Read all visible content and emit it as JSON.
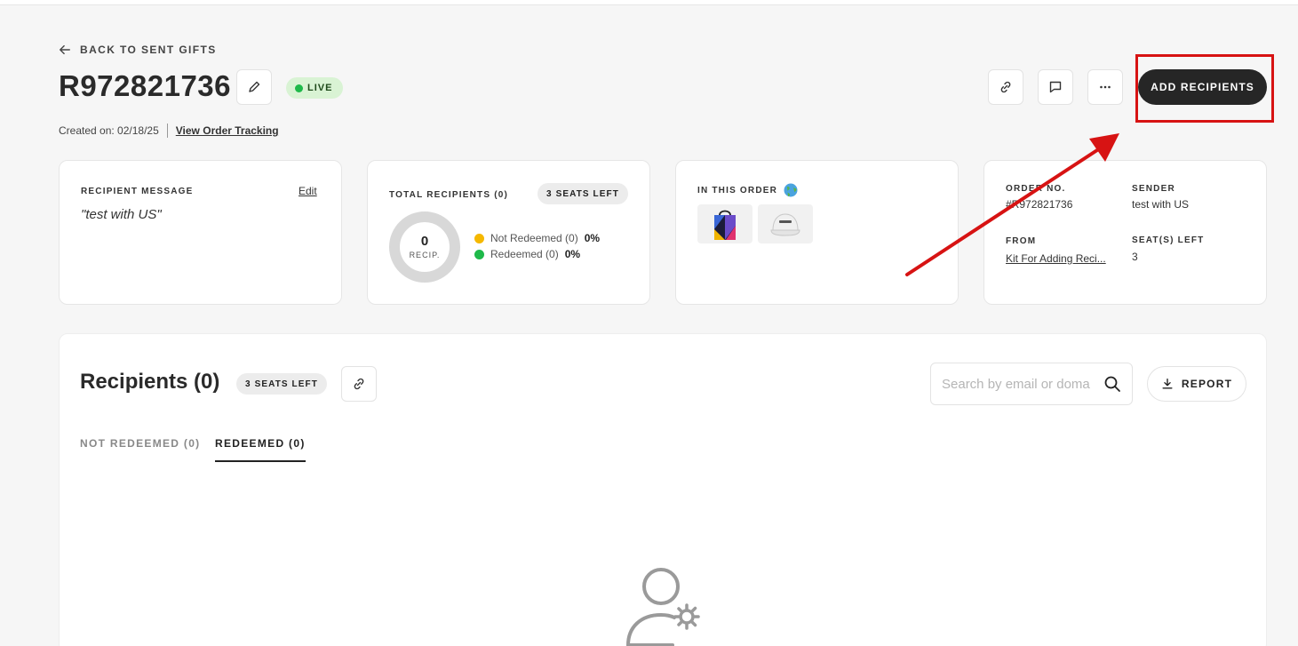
{
  "header": {
    "back_label": "BACK TO SENT GIFTS",
    "order_id": "R972821736",
    "status": "LIVE",
    "created_on": "Created on: 02/18/25",
    "tracking_link": "View Order Tracking",
    "add_recipients_label": "ADD RECIPIENTS"
  },
  "message_card": {
    "label": "RECIPIENT MESSAGE",
    "edit_label": "Edit",
    "message": "\"test with US\""
  },
  "recipients_card": {
    "label": "TOTAL RECIPIENTS (0)",
    "seats_left": "3 SEATS LEFT",
    "donut_value": "0",
    "donut_unit": "RECIP.",
    "legend": [
      {
        "label": "Not Redeemed (0)",
        "percent": "0%",
        "color": "#f5b800"
      },
      {
        "label": "Redeemed (0)",
        "percent": "0%",
        "color": "#1fb94a"
      }
    ]
  },
  "order_card": {
    "label": "IN THIS ORDER"
  },
  "info_card": {
    "order_no_label": "ORDER NO.",
    "order_no_value": "#R972821736",
    "sender_label": "SENDER",
    "sender_value": "test with US",
    "from_label": "FROM",
    "from_value": "Kit For Adding Reci...",
    "seats_label": "SEAT(S) LEFT",
    "seats_value": "3"
  },
  "recipients_section": {
    "title": "Recipients (0)",
    "seats_left": "3 SEATS LEFT",
    "search_placeholder": "Search by email or doma",
    "report_label": "REPORT",
    "tabs": [
      {
        "label": "NOT REDEEMED (0)",
        "active": false
      },
      {
        "label": "REDEEMED (0)",
        "active": true
      }
    ]
  },
  "colors": {
    "primary_button": "#262626",
    "live_badge_bg": "#d9f3d4",
    "live_dot": "#1fb94a",
    "annotation_red": "#d71313"
  }
}
